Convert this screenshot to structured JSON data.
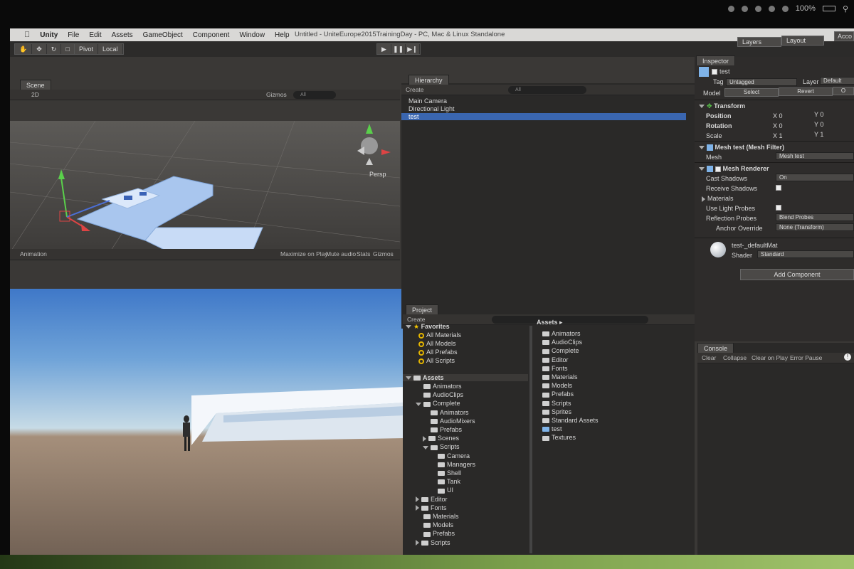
{
  "mac_menubar": {
    "battery": "100%",
    "search_icon": "magnifier"
  },
  "menubar": {
    "items": [
      "Unity",
      "File",
      "Edit",
      "Assets",
      "GameObject",
      "Component",
      "Window",
      "Help"
    ],
    "window_title": "Untitled - UniteEurope2015TrainingDay - PC, Mac & Linux Standalone"
  },
  "toolbar": {
    "pivot": "Pivot",
    "local": "Local",
    "layers": "Layers",
    "layout": "Layout",
    "account": "Acco"
  },
  "scene": {
    "tab": "Scene",
    "shading": "2D",
    "gizmos": "Gizmos",
    "search": "All",
    "persp": "Persp"
  },
  "game": {
    "tab": "Animation",
    "maximize": "Maximize on Play",
    "mute": "Mute audio",
    "stats": "Stats",
    "gizmos": "Gizmos"
  },
  "hierarchy": {
    "tab": "Hierarchy",
    "create": "Create",
    "search": "All",
    "items": [
      {
        "label": "Main Camera"
      },
      {
        "label": "Directional Light"
      },
      {
        "label": "test"
      }
    ]
  },
  "project": {
    "tab": "Project",
    "create": "Create",
    "favorites": "Favorites",
    "favorite_items": [
      "All Materials",
      "All Models",
      "All Prefabs",
      "All Scripts"
    ],
    "assets": "Assets",
    "tree": [
      {
        "label": "Animators",
        "indent": 1
      },
      {
        "label": "AudioClips",
        "indent": 1
      },
      {
        "label": "Complete",
        "indent": 1,
        "open": true
      },
      {
        "label": "Animators",
        "indent": 2
      },
      {
        "label": "AudioMixers",
        "indent": 2
      },
      {
        "label": "Prefabs",
        "indent": 2
      },
      {
        "label": "Scenes",
        "indent": 2,
        "closed": true
      },
      {
        "label": "Scripts",
        "indent": 2,
        "open": true
      },
      {
        "label": "Camera",
        "indent": 3
      },
      {
        "label": "Managers",
        "indent": 3
      },
      {
        "label": "Shell",
        "indent": 3
      },
      {
        "label": "Tank",
        "indent": 3
      },
      {
        "label": "UI",
        "indent": 3
      },
      {
        "label": "Editor",
        "indent": 1,
        "closed": true
      },
      {
        "label": "Fonts",
        "indent": 1,
        "closed": true
      },
      {
        "label": "Materials",
        "indent": 1
      },
      {
        "label": "Models",
        "indent": 1
      },
      {
        "label": "Prefabs",
        "indent": 1
      },
      {
        "label": "Scripts",
        "indent": 1,
        "closed": true
      }
    ],
    "breadcrumb": "Assets",
    "grid": [
      "Animators",
      "AudioClips",
      "Complete",
      "Editor",
      "Fonts",
      "Materials",
      "Models",
      "Prefabs",
      "Scripts",
      "Sprites",
      "Standard Assets",
      "test",
      "Textures"
    ]
  },
  "inspector": {
    "tab": "Inspector",
    "object_name": "test",
    "tag_label": "Tag",
    "tag": "Untagged",
    "layer_label": "Layer",
    "layer": "Default",
    "model_label": "Model",
    "select": "Select",
    "revert": "Revert",
    "open": "O",
    "transform": "Transform",
    "position": "Position",
    "rotation": "Rotation",
    "scale": "Scale",
    "pos": {
      "x": "0",
      "y": "0"
    },
    "rot": {
      "x": "0",
      "y": "0"
    },
    "scl": {
      "x": "1",
      "y": "1"
    },
    "mesh_filter": "Mesh test (Mesh Filter)",
    "mesh_label": "Mesh",
    "mesh_value": "Mesh test",
    "mesh_renderer": "Mesh Renderer",
    "cast_shadows": "Cast Shadows",
    "cast_shadows_val": "On",
    "receive_shadows": "Receive Shadows",
    "materials": "Materials",
    "use_light_probes": "Use Light Probes",
    "reflection_probes": "Reflection Probes",
    "reflection_val": "Blend Probes",
    "anchor_override": "Anchor Override",
    "anchor_val": "None (Transform)",
    "material_name": "test-_defaultMat",
    "shader_label": "Shader",
    "shader_val": "Standard",
    "add_component": "Add Component"
  },
  "console": {
    "tab": "Console",
    "clear": "Clear",
    "collapse": "Collapse",
    "clear_on_play": "Clear on Play",
    "error_pause": "Error Pause"
  }
}
